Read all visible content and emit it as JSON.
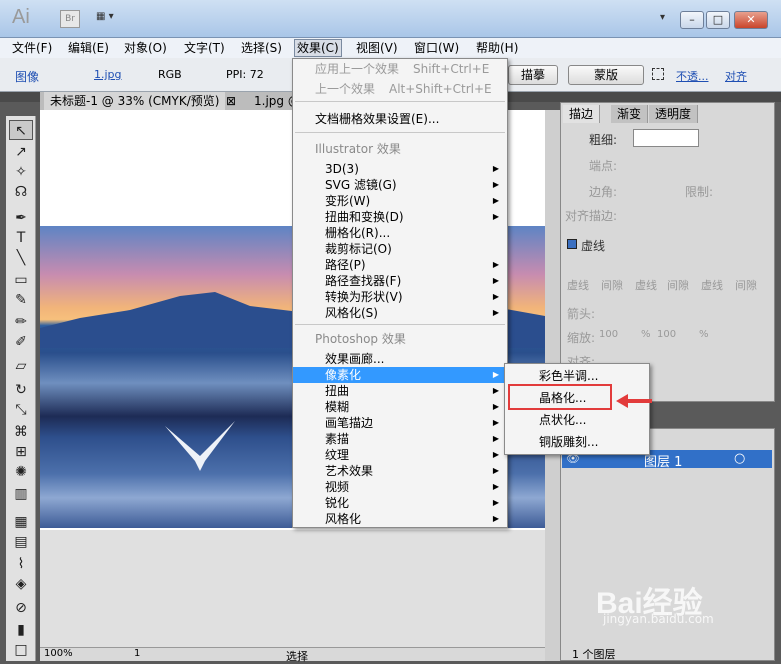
{
  "titlebar": {
    "logo": "Ai",
    "bridge": "Br",
    "arrange": "▦ ▾",
    "collapse": "▾",
    "minimize": "–",
    "maximize": "□",
    "close": "✕"
  },
  "menubar": {
    "items": [
      "文件(F)",
      "编辑(E)",
      "对象(O)",
      "文字(T)",
      "选择(S)",
      "效果(C)",
      "视图(V)",
      "窗口(W)",
      "帮助(H)"
    ]
  },
  "controlbar": {
    "image_label": "图像",
    "file": "1.jpg",
    "mode": "RGB",
    "ppi": "PPI: 72",
    "trace_btn": "描摹",
    "mask_btn": "蒙版",
    "opacity": "不透...",
    "align": "对齐"
  },
  "tabs": {
    "doc1": "未标题-1 @ 33% (CMYK/预览)",
    "close": "⊠",
    "doc2": "1.jpg @"
  },
  "effect_menu": {
    "apply_last": "应用上一个效果",
    "apply_last_sc": "Shift+Ctrl+E",
    "last": "上一个效果",
    "last_sc": "Alt+Shift+Ctrl+E",
    "raster_settings": "文档栅格效果设置(E)...",
    "illustrator_header": "Illustrator 效果",
    "illustrator_items": [
      "3D(3)",
      "SVG 滤镜(G)",
      "变形(W)",
      "扭曲和变换(D)",
      "栅格化(R)...",
      "裁剪标记(O)",
      "路径(P)",
      "路径查找器(F)",
      "转换为形状(V)",
      "风格化(S)"
    ],
    "photoshop_header": "Photoshop 效果",
    "photoshop_items": [
      "效果画廊...",
      "像素化",
      "扭曲",
      "模糊",
      "画笔描边",
      "素描",
      "纹理",
      "艺术效果",
      "视频",
      "锐化",
      "风格化"
    ]
  },
  "pixelate_submenu": {
    "items": [
      "彩色半调...",
      "晶格化...",
      "点状化...",
      "铜版雕刻..."
    ]
  },
  "stroke_panel": {
    "tabs": [
      "描边",
      "渐变",
      "透明度"
    ],
    "weight": "粗细:",
    "cap": "端点:",
    "corner": "边角:",
    "limit": "限制:",
    "align_stroke": "对齐描边:",
    "dashed": "虚线",
    "dash_labels": [
      "虚线",
      "间隙",
      "虚线",
      "间隙",
      "虚线",
      "间隙"
    ],
    "arrow": "箭头:",
    "scale": "缩放:",
    "scale_val1": "100",
    "scale_val2": "100",
    "pct": "%",
    "align2": "对齐:"
  },
  "layers_panel": {
    "layer_name": "图层 1",
    "count": "1 个图层"
  },
  "statusbar": {
    "zoom": "100%",
    "page": "1",
    "mode": "选择"
  },
  "watermark": {
    "logo": "Bai经验",
    "url": "jingyan.baidu.com"
  },
  "colors": {
    "highlight": "#3399ff",
    "annotation": "#e23b3b",
    "layer_select": "#3170c8"
  }
}
